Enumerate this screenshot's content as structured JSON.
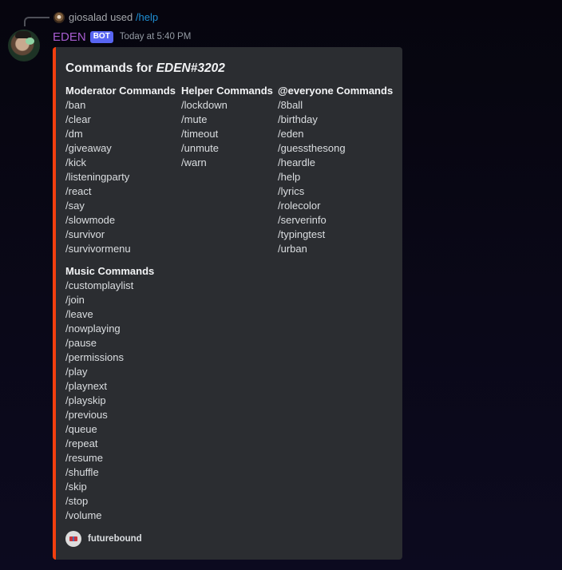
{
  "reply": {
    "username": "giosalad",
    "used": "used",
    "command": "/help"
  },
  "message": {
    "author": "EDEN",
    "bot_tag": "BOT",
    "timestamp": "Today at 5:40 PM"
  },
  "embed": {
    "accent_color": "#f23f0f",
    "title_prefix": "Commands for ",
    "title_bot": "EDEN#3202",
    "fields": {
      "moderator": {
        "name": "Moderator Commands",
        "commands": [
          "/ban",
          "/clear",
          "/dm",
          "/giveaway",
          "/kick",
          "/listeningparty",
          "/react",
          "/say",
          "/slowmode",
          "/survivor",
          "/survivormenu"
        ]
      },
      "helper": {
        "name": "Helper Commands",
        "commands": [
          "/lockdown",
          "/mute",
          "/timeout",
          "/unmute",
          "/warn"
        ]
      },
      "everyone": {
        "name": "@everyone Commands",
        "commands": [
          "/8ball",
          "/birthday",
          "/eden",
          "/guessthesong",
          "/heardle",
          "/help",
          "/lyrics",
          "/rolecolor",
          "/serverinfo",
          "/typingtest",
          "/urban"
        ]
      },
      "music": {
        "name": "Music Commands",
        "commands": [
          "/customplaylist",
          "/join",
          "/leave",
          "/nowplaying",
          "/pause",
          "/permissions",
          "/play",
          "/playnext",
          "/playskip",
          "/previous",
          "/queue",
          "/repeat",
          "/resume",
          "/shuffle",
          "/skip",
          "/stop",
          "/volume"
        ]
      }
    },
    "footer": {
      "text": "futurebound",
      "icon": "futurebound-server-icon"
    }
  },
  "colors": {
    "username": "#a65ccf",
    "bot_tag": "#5865f2",
    "command_link": "#1f8fd4",
    "embed_bg": "#2b2d31"
  }
}
